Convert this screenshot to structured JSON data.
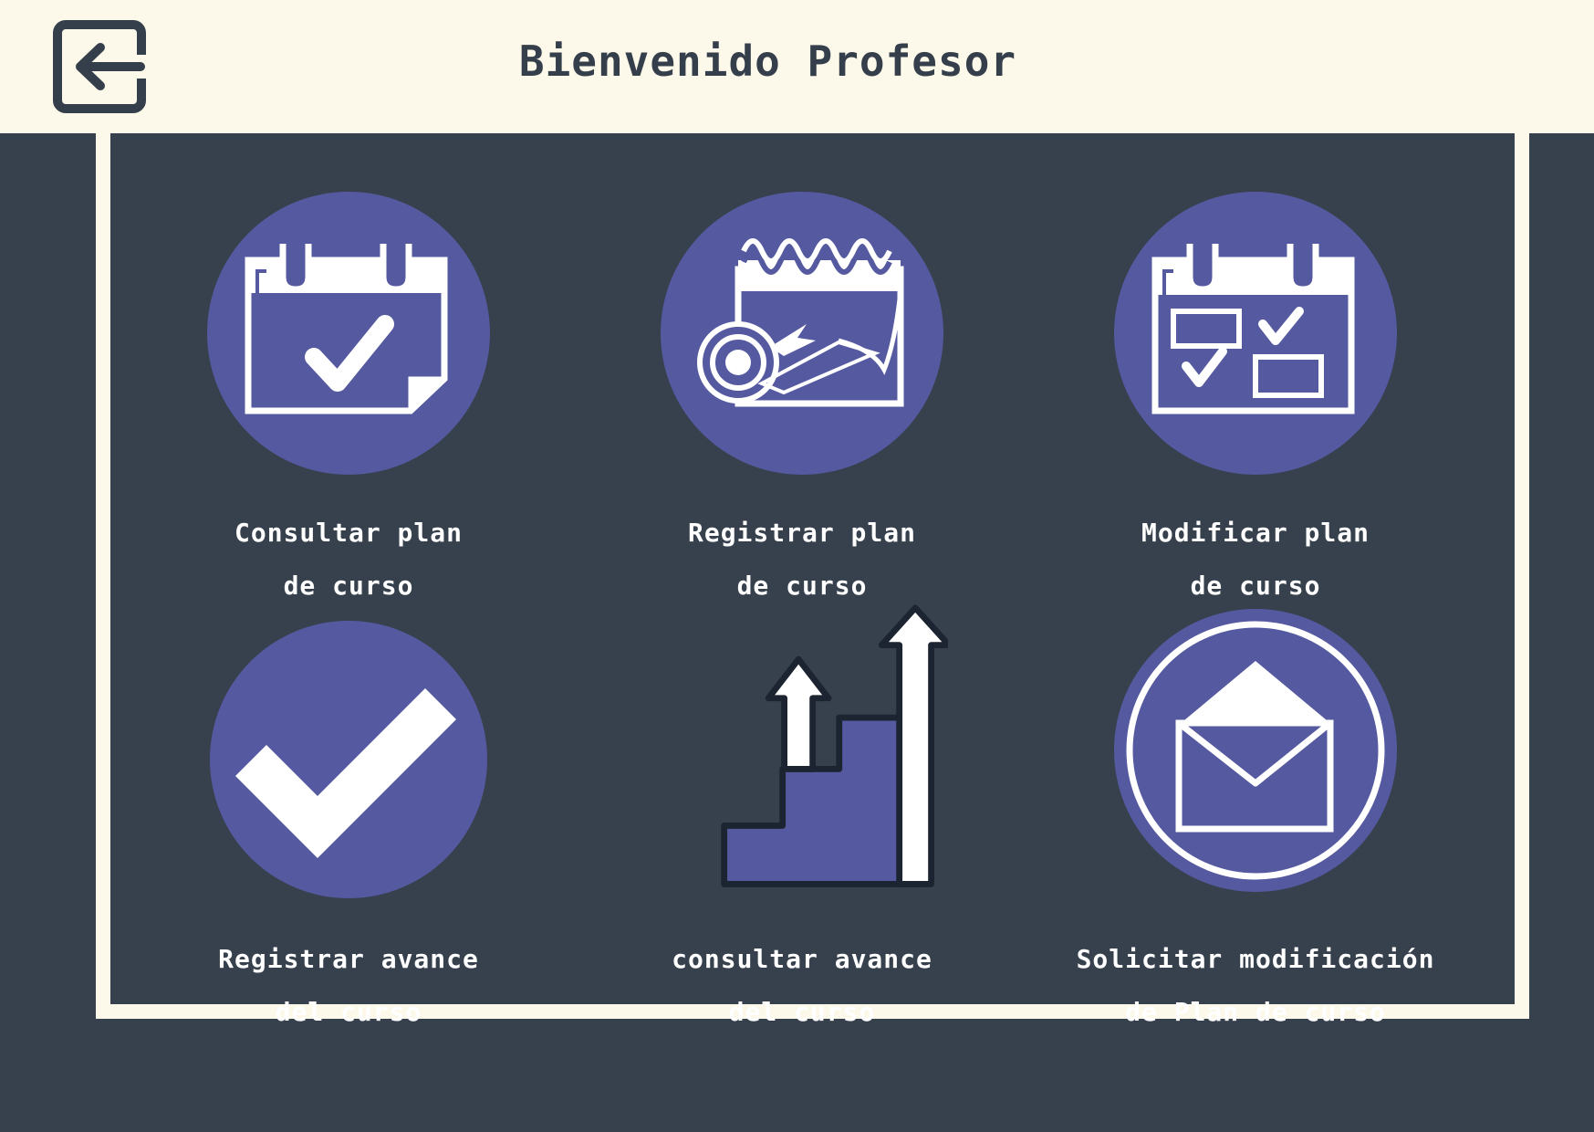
{
  "header": {
    "title": "Bienvenido Profesor",
    "back_icon": "logout-arrow-icon"
  },
  "colors": {
    "background": "#36414d",
    "header_bg": "#fdf9ea",
    "accent": "#5559a0",
    "icon_fg": "#ffffff",
    "text": "#ffffff"
  },
  "menu": {
    "tiles": [
      {
        "line1": "Consultar plan",
        "line2": "de curso",
        "icon": "calendar-check-icon"
      },
      {
        "line1": "Registrar plan",
        "line2": "de curso",
        "icon": "calendar-target-icon"
      },
      {
        "line1": "Modificar plan",
        "line2": "de curso",
        "icon": "calendar-checklist-icon"
      },
      {
        "line1": "Registrar avance",
        "line2": "del curso",
        "icon": "checkmark-icon"
      },
      {
        "line1": "consultar avance",
        "line2": "del curso",
        "icon": "progress-stairs-icon"
      },
      {
        "line1": "Solicitar modificación",
        "line2": "de Plan de curso",
        "icon": "envelope-icon"
      }
    ]
  }
}
